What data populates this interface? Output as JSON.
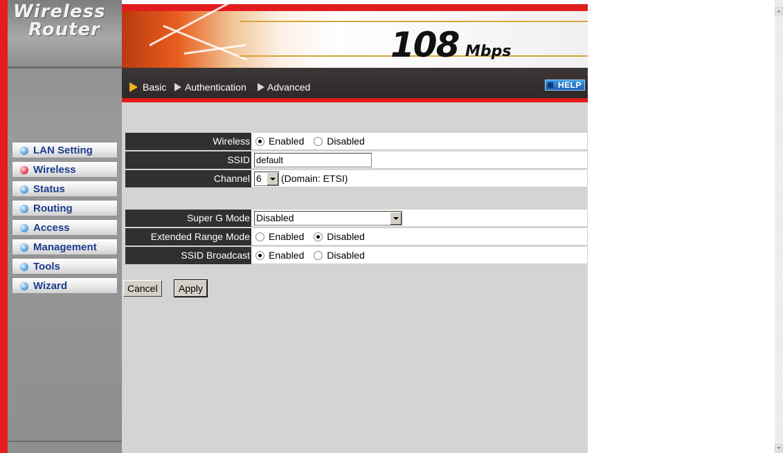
{
  "logo": {
    "line1": "Wireless",
    "line2": "Router"
  },
  "banner": {
    "speed": "108",
    "speed_unit": "Mbps"
  },
  "nav": {
    "items": [
      "Basic",
      "Authentication",
      "Advanced"
    ],
    "help_label": "HELP"
  },
  "sidebar": {
    "items": [
      {
        "label": "LAN Setting",
        "active": false
      },
      {
        "label": "Wireless",
        "active": true
      },
      {
        "label": "Status",
        "active": false
      },
      {
        "label": "Routing",
        "active": false
      },
      {
        "label": "Access",
        "active": false
      },
      {
        "label": "Management",
        "active": false
      },
      {
        "label": "Tools",
        "active": false
      },
      {
        "label": "Wizard",
        "active": false
      }
    ]
  },
  "form": {
    "wireless": {
      "label": "Wireless",
      "enabled": "Enabled",
      "disabled": "Disabled",
      "value": "Enabled"
    },
    "ssid": {
      "label": "SSID",
      "value": "default"
    },
    "channel": {
      "label": "Channel",
      "value": "6",
      "domain": "(Domain: ETSI)"
    },
    "super_g": {
      "label": "Super G Mode",
      "value": "Disabled"
    },
    "extended_range": {
      "label": "Extended Range Mode",
      "enabled": "Enabled",
      "disabled": "Disabled",
      "value": "Disabled"
    },
    "ssid_broadcast": {
      "label": "SSID Broadcast",
      "enabled": "Enabled",
      "disabled": "Disabled",
      "value": "Enabled"
    }
  },
  "buttons": {
    "cancel": "Cancel",
    "apply": "Apply"
  },
  "colors": {
    "accent_red": "#e21c1c",
    "nav_dark": "#2e2828",
    "menu_text": "#1c3c8e",
    "label_bg": "#303030"
  }
}
